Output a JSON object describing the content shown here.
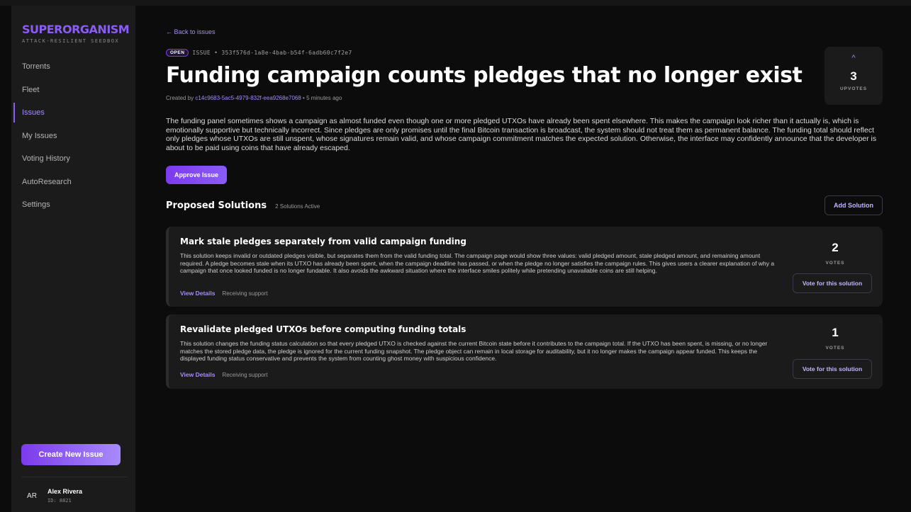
{
  "sidebar": {
    "brand_title": "SUPERORGANISM",
    "brand_subtitle": "ATTACK-RESILIENT SEEDBOX",
    "items": [
      {
        "label": "Torrents"
      },
      {
        "label": "Fleet"
      },
      {
        "label": "Issues",
        "active": true
      },
      {
        "label": "My Issues"
      },
      {
        "label": "Voting History"
      },
      {
        "label": "AutoResearch"
      },
      {
        "label": "Settings"
      }
    ],
    "create_button": "Create New Issue",
    "user": {
      "initials": "AR",
      "name": "Alex Rivera",
      "id": "ID: 8821"
    }
  },
  "issue": {
    "back_link": "← Back to issues",
    "status_badge": "OPEN",
    "id_line": "ISSUE • 353f576d-1a8e-4bab-b54f-6adb60c7f2e7",
    "title": "Funding campaign counts pledges that no longer exist",
    "created_prefix": "Created by ",
    "created_author": "c14c9683-5ac5-4979-832f-eea9268e7068",
    "created_suffix": " • 5 minutes ago",
    "upvote_arrow": "^",
    "upvotes": "3",
    "upvotes_label": "UPVOTES",
    "description": "The funding panel sometimes shows a campaign as almost funded even though one or more pledged UTXOs have already been spent elsewhere. This makes the campaign look richer than it actually is, which is emotionally supportive but technically incorrect. Since pledges are only promises until the final Bitcoin transaction is broadcast, the system should not treat them as permanent balance. The funding total should reflect only pledges whose UTXOs are still unspent, whose signatures remain valid, and whose campaign commitment matches the expected solution. Otherwise, the interface may confidently announce that the developer is about to be paid using coins that have already escaped.",
    "approve_button": "Approve Issue"
  },
  "solutions": {
    "header": "Proposed Solutions",
    "active_count": "2 Solutions Active",
    "add_button": "Add Solution",
    "items": [
      {
        "title": "Mark stale pledges separately from valid campaign funding",
        "body": "This solution keeps invalid or outdated pledges visible, but separates them from the valid funding total. The campaign page would show three values: valid pledged amount, stale pledged amount, and remaining amount required. A pledge becomes stale when its UTXO has already been spent, when the campaign deadline has passed, or when the pledge no longer satisfies the campaign rules. This gives users a clearer explanation of why a campaign that once looked funded is no longer fundable. It also avoids the awkward situation where the interface smiles politely while pretending unavailable coins are still helping.",
        "view_details": "View Details",
        "status": "Receiving support",
        "votes": "2",
        "votes_label": "VOTES",
        "vote_button": "Vote for this solution"
      },
      {
        "title": "Revalidate pledged UTXOs before computing funding totals",
        "body": "This solution changes the funding status calculation so that every pledged UTXO is checked against the current Bitcoin state before it contributes to the campaign total. If the UTXO has been spent, is missing, or no longer matches the stored pledge data, the pledge is ignored for the current funding snapshot. The pledge object can remain in local storage for auditability, but it no longer makes the campaign appear funded. This keeps the displayed funding status conservative and prevents the system from counting ghost money with suspicious confidence.",
        "view_details": "View Details",
        "status": "Receiving support",
        "votes": "1",
        "votes_label": "VOTES",
        "vote_button": "Vote for this solution"
      }
    ]
  },
  "colors": {
    "accent": "#8b5cf6",
    "accent_light": "#a78bfa",
    "background": "#0c0c0c",
    "panel": "#1b1b1b"
  }
}
